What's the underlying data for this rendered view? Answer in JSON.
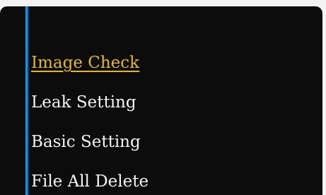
{
  "menu": {
    "items": [
      {
        "label": "Image Check",
        "selected": true
      },
      {
        "label": "Leak Setting",
        "selected": false
      },
      {
        "label": "Basic Setting",
        "selected": false
      },
      {
        "label": "File All Delete",
        "selected": false
      }
    ]
  },
  "colors": {
    "background": "#0c0c0c",
    "accent_bar": "#2a8fd0",
    "selected_text": "#e6b820",
    "normal_text": "#f4f4f4"
  }
}
